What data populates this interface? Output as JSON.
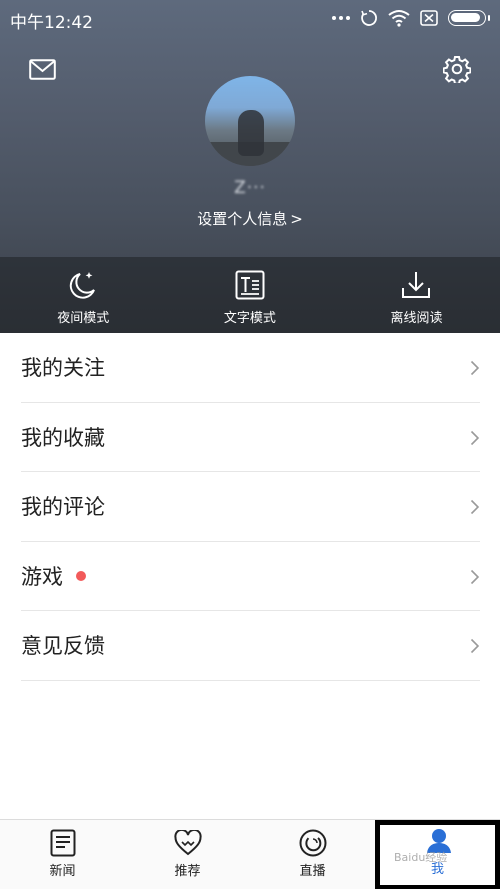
{
  "status_bar": {
    "time": "中午12:42"
  },
  "header": {
    "username": "Z···",
    "profile_link": "设置个人信息",
    "modes": [
      {
        "label": "夜间模式",
        "icon": "moon-icon"
      },
      {
        "label": "文字模式",
        "icon": "text-mode-icon"
      },
      {
        "label": "离线阅读",
        "icon": "download-icon"
      }
    ]
  },
  "menu": {
    "items": [
      {
        "label": "我的关注",
        "badge": false
      },
      {
        "label": "我的收藏",
        "badge": false
      },
      {
        "label": "我的评论",
        "badge": false
      },
      {
        "label": "游戏",
        "badge": true
      },
      {
        "label": "意见反馈",
        "badge": false
      }
    ]
  },
  "bottom_nav": {
    "tabs": [
      {
        "label": "新闻",
        "icon": "news-icon",
        "active": false
      },
      {
        "label": "推荐",
        "icon": "heart-icon",
        "active": false
      },
      {
        "label": "直播",
        "icon": "live-icon",
        "active": false
      },
      {
        "label": "我",
        "icon": "user-icon",
        "active": true
      }
    ],
    "watermark": "Baidu经验"
  },
  "colors": {
    "accent": "#2a6fd6",
    "badge": "#f25a5a"
  }
}
